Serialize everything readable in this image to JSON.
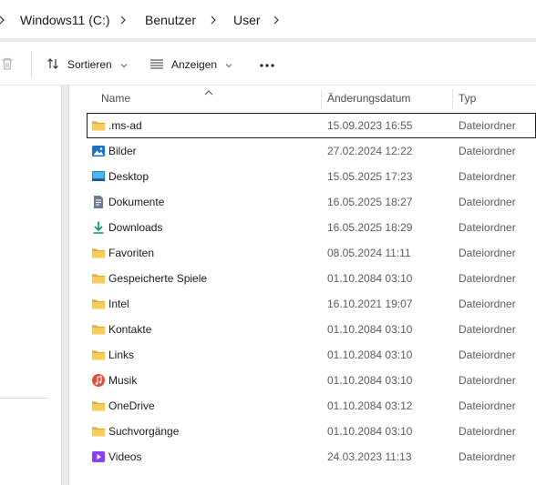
{
  "breadcrumb": {
    "items": [
      "Windows11 (C:)",
      "Benutzer",
      "User"
    ]
  },
  "toolbar": {
    "sort_label": "Sortieren",
    "view_label": "Anzeigen",
    "more_label": "···"
  },
  "columns": {
    "name": "Name",
    "date": "Änderungsdatum",
    "type": "Typ"
  },
  "files": [
    {
      "name": ".ms-ad",
      "date": "15.09.2023 16:55",
      "type": "Dateiordner",
      "icon": "folder-icon",
      "selected": true
    },
    {
      "name": "Bilder",
      "date": "27.02.2024 12:22",
      "type": "Dateiordner",
      "icon": "pictures-icon"
    },
    {
      "name": "Desktop",
      "date": "15.05.2025 17:23",
      "type": "Dateiordner",
      "icon": "desktop-icon"
    },
    {
      "name": "Dokumente",
      "date": "16.05.2025 18:27",
      "type": "Dateiordner",
      "icon": "documents-icon"
    },
    {
      "name": "Downloads",
      "date": "16.05.2025 18:29",
      "type": "Dateiordner",
      "icon": "download-icon"
    },
    {
      "name": "Favoriten",
      "date": "08.05.2024 11:11",
      "type": "Dateiordner",
      "icon": "folder-icon"
    },
    {
      "name": "Gespeicherte Spiele",
      "date": "01.10.2084 03:10",
      "type": "Dateiordner",
      "icon": "folder-icon"
    },
    {
      "name": "Intel",
      "date": "16.10.2021 19:07",
      "type": "Dateiordner",
      "icon": "folder-icon"
    },
    {
      "name": "Kontakte",
      "date": "01.10.2084 03:10",
      "type": "Dateiordner",
      "icon": "folder-icon"
    },
    {
      "name": "Links",
      "date": "01.10.2084 03:10",
      "type": "Dateiordner",
      "icon": "folder-icon"
    },
    {
      "name": "Musik",
      "date": "01.10.2084 03:10",
      "type": "Dateiordner",
      "icon": "music-icon"
    },
    {
      "name": "OneDrive",
      "date": "01.10.2084 03:12",
      "type": "Dateiordner",
      "icon": "folder-icon"
    },
    {
      "name": "Suchvorgänge",
      "date": "01.10.2084 03:10",
      "type": "Dateiordner",
      "icon": "folder-icon"
    },
    {
      "name": "Videos",
      "date": "24.03.2023 11:13",
      "type": "Dateiordner",
      "icon": "videos-icon"
    }
  ],
  "colors": {
    "folder": "#f4c04e",
    "accent": "#0067c0",
    "download": "#1a9a6c",
    "videos": "#8a3ffc",
    "music": "#e0503c"
  }
}
